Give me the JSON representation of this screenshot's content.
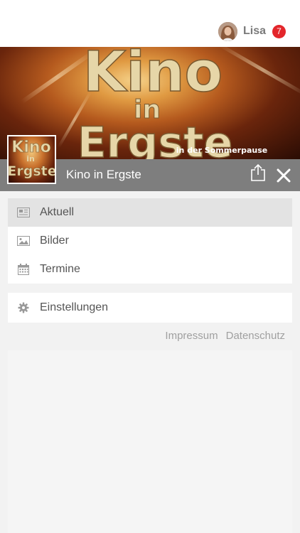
{
  "user": {
    "name": "Lisa",
    "notifications": "7"
  },
  "banner": {
    "line1": "Kino",
    "line2": "in",
    "line3": "Ergste",
    "subtitle": "in der Sommerpause"
  },
  "thumb": {
    "line1": "Kino",
    "line2": "in",
    "line3": "Ergste"
  },
  "page": {
    "name": "Kino in Ergste"
  },
  "menu": {
    "items": [
      {
        "label": "Aktuell",
        "icon": "newspaper-icon",
        "active": true
      },
      {
        "label": "Bilder",
        "icon": "image-icon",
        "active": false
      },
      {
        "label": "Termine",
        "icon": "calendar-icon",
        "active": false
      }
    ],
    "settings": {
      "label": "Einstellungen",
      "icon": "gear-icon"
    }
  },
  "footer": {
    "impressum": "Impressum",
    "datenschutz": "Datenschutz"
  },
  "colors": {
    "badge": "#e3262b",
    "strip": "#7e7e7e",
    "active": "#e3e3e3"
  }
}
